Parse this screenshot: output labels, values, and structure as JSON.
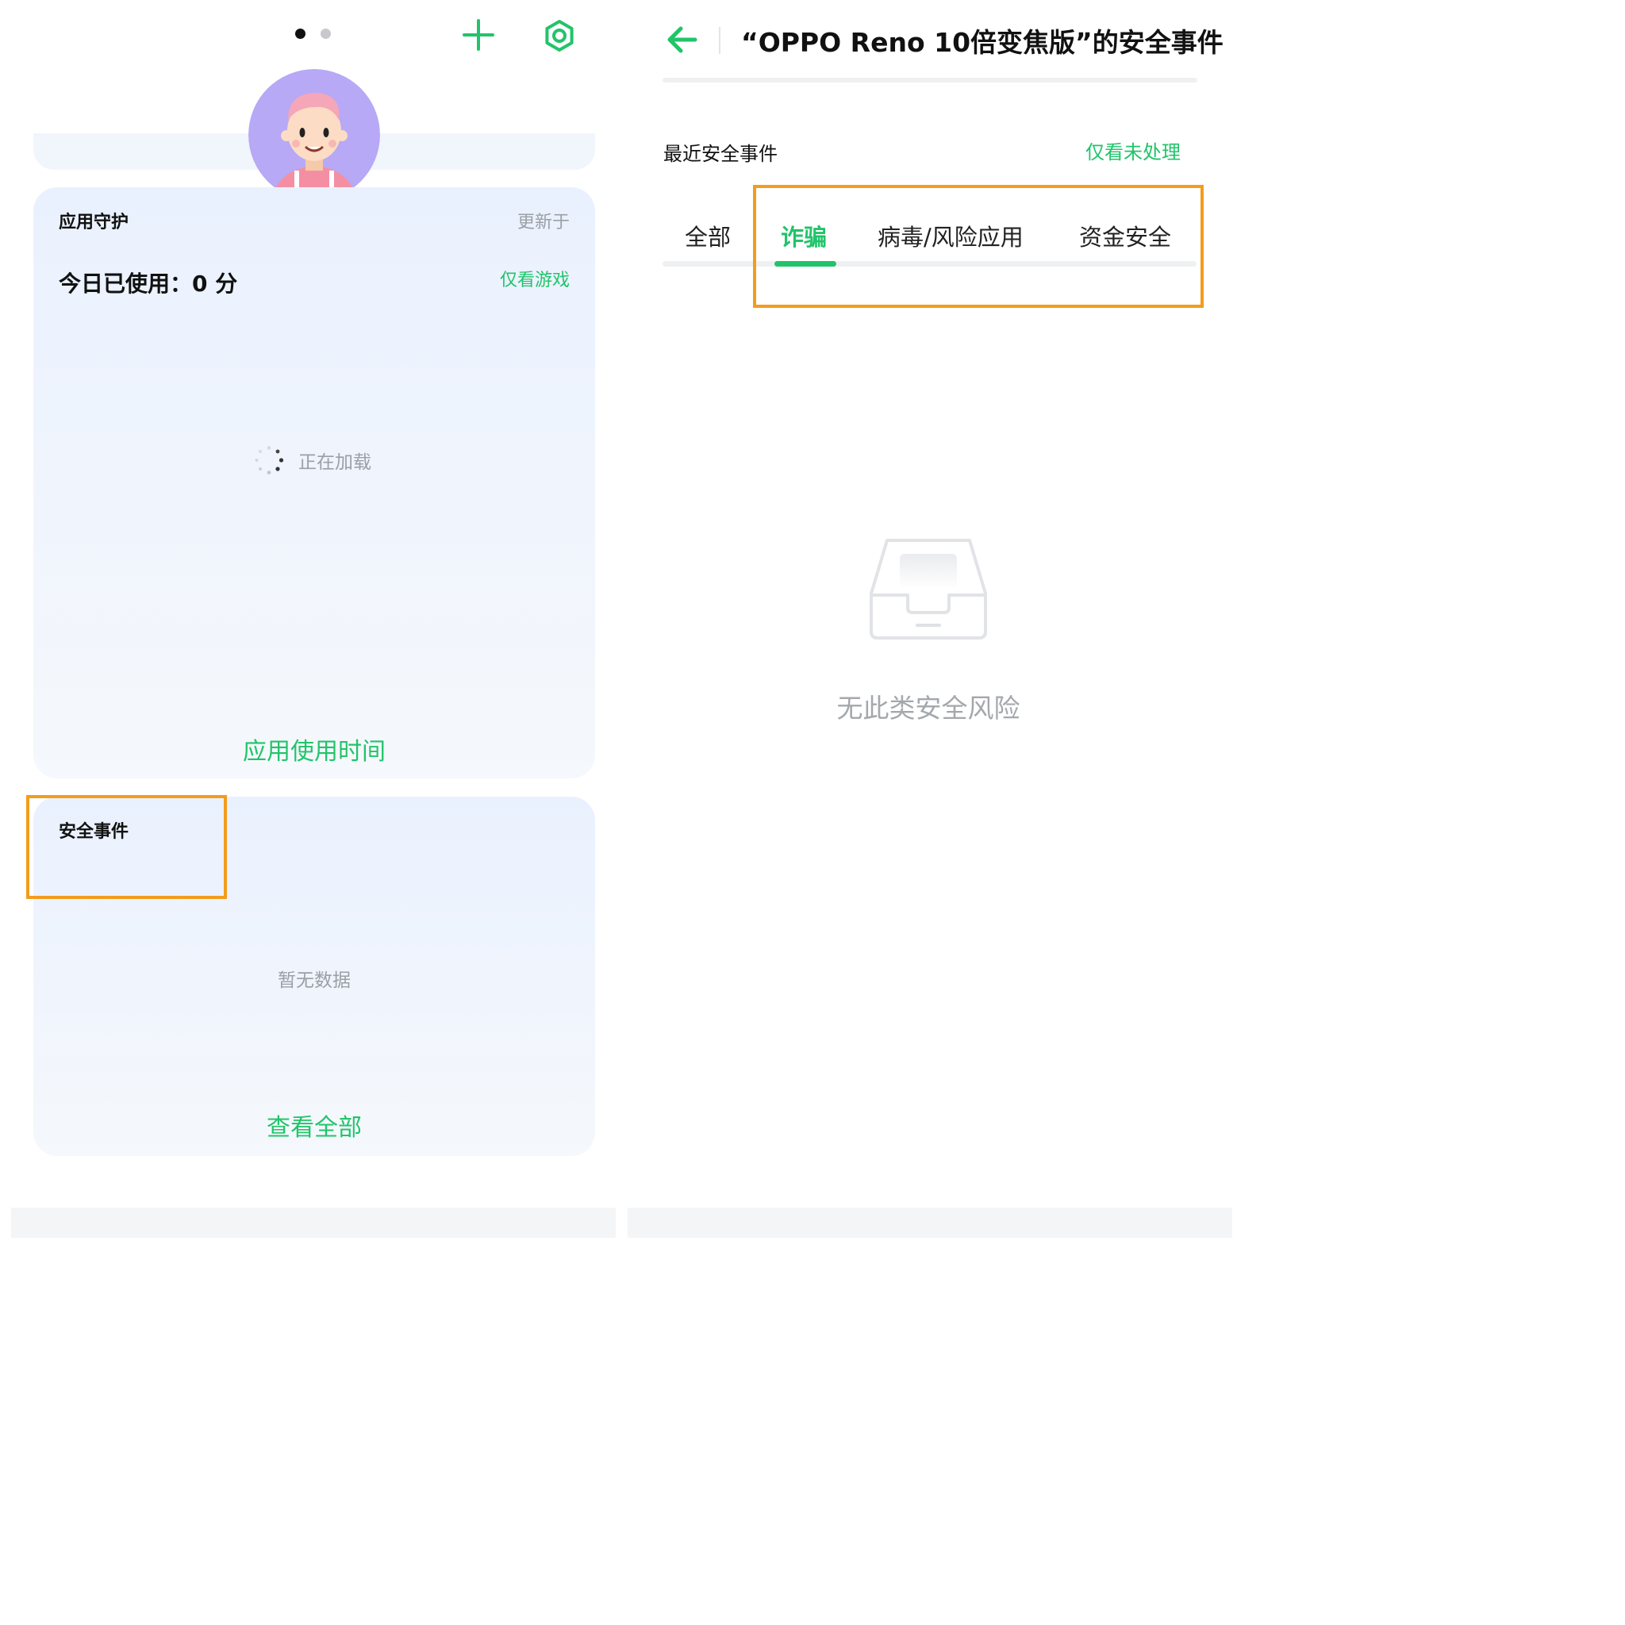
{
  "left_panel": {
    "page_indicator": {
      "count": 2,
      "active": 1
    },
    "app_guard_card": {
      "title": "应用守护",
      "updated_label": "更新于",
      "usage_today": "今日已使用：0 分",
      "games_only_link": "仅看游戏",
      "loading_text": "正在加载",
      "footer_link": "应用使用时间"
    },
    "security_card": {
      "title": "安全事件",
      "no_data_text": "暂无数据",
      "footer_link": "查看全部"
    }
  },
  "right_panel": {
    "title": "“OPPO Reno 10倍变焦版”的安全事件",
    "section_label": "最近安全事件",
    "unprocessed_filter_link": "仅看未处理",
    "tabs": [
      {
        "label": "全部",
        "active": false
      },
      {
        "label": "诈骗",
        "active": true
      },
      {
        "label": "病毒/风险应用",
        "active": false
      },
      {
        "label": "资金安全",
        "active": false
      }
    ],
    "empty_state_text": "无此类安全风险"
  },
  "colors": {
    "accent": "#21c46a",
    "highlight": "#f39c1d",
    "card_bg": "#eaf1fe",
    "avatar_bg": "#b7a9f5"
  },
  "icons": [
    "plus-icon",
    "settings-icon",
    "avatar-image",
    "back-arrow-icon",
    "loading-spinner-icon",
    "empty-inbox-icon"
  ]
}
